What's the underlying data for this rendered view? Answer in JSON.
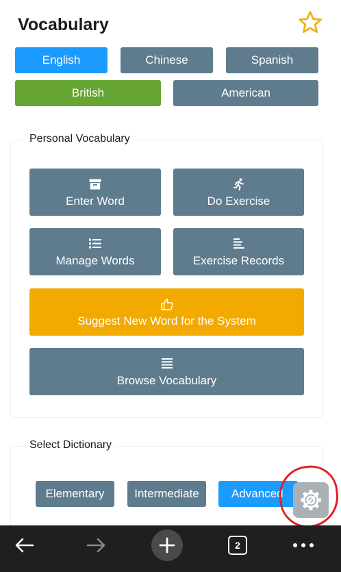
{
  "header": {
    "title": "Vocabulary"
  },
  "languages": [
    "English",
    "Chinese",
    "Spanish"
  ],
  "variants": [
    "British",
    "American"
  ],
  "personal": {
    "legend": "Personal Vocabulary",
    "enter_word": "Enter Word",
    "do_exercise": "Do Exercise",
    "manage_words": "Manage Words",
    "exercise_records": "Exercise Records",
    "suggest": "Suggest New Word for the System",
    "browse": "Browse Vocabulary"
  },
  "dictionary": {
    "legend": "Select Dictionary",
    "options": [
      "Elementary",
      "Intermediate",
      "Advanced"
    ]
  },
  "browser": {
    "tab_count": "2"
  },
  "colors": {
    "accent_blue": "#1c9bff",
    "gray": "#5f7c8e",
    "green": "#66a532",
    "yellow": "#f2a900",
    "star": "#f2b01e"
  }
}
